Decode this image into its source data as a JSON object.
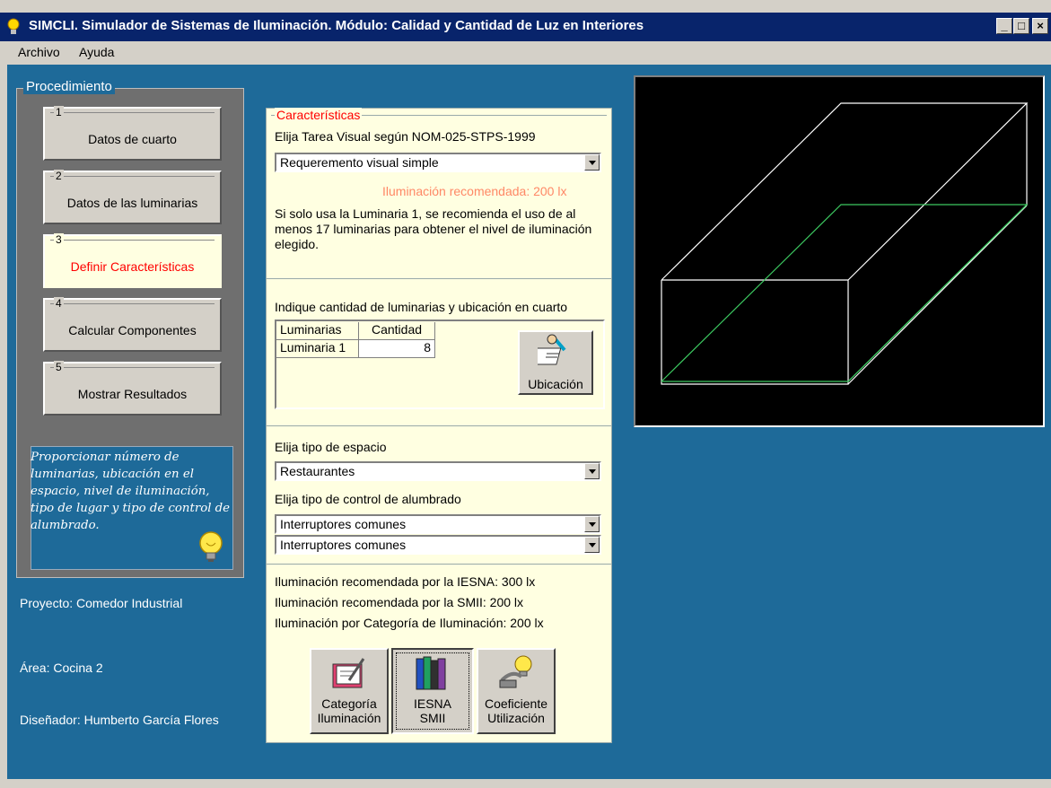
{
  "window": {
    "title": "SIMCLI. Simulador de Sistemas de Iluminación. Módulo: Calidad y Cantidad de Luz en Interiores",
    "buttons": {
      "min": "_",
      "max": "□",
      "close": "×"
    }
  },
  "menu": [
    "Archivo",
    "Ayuda"
  ],
  "procedure": {
    "legend": "Procedimiento",
    "steps": [
      {
        "num": "1",
        "label": "Datos de cuarto"
      },
      {
        "num": "2",
        "label": "Datos de las luminarias"
      },
      {
        "num": "3",
        "label": "Definir Características"
      },
      {
        "num": "4",
        "label": "Calcular Componentes"
      },
      {
        "num": "5",
        "label": "Mostrar Resultados"
      }
    ],
    "active_step": 3,
    "hint": "Proporcionar número de luminarias, ubicación en el espacio, nivel de iluminación, tipo de lugar y tipo de control de alumbrado."
  },
  "project": {
    "proyecto": "Proyecto: Comedor Industrial",
    "area": "Área: Cocina 2",
    "disenador": "Diseñador: Humberto García Flores"
  },
  "characteristics": {
    "legend": "Características",
    "task_label": "Elija Tarea Visual según NOM-025-STPS-1999",
    "task_value": "Requeremento visual simple",
    "recommended": "Iluminación recomendada: 200  lx",
    "note": "Si solo usa la Luminaria 1, se recomienda el uso de al menos 17 luminarias para obtener el nivel de iluminación elegido."
  },
  "luminaires": {
    "label": "Indique cantidad de luminarias y ubicación en cuarto",
    "headers": [
      "Luminarias",
      "Cantidad"
    ],
    "rows": [
      {
        "name": "Luminaria 1",
        "qty": "8"
      }
    ],
    "location_button": "Ubicación"
  },
  "space": {
    "type_label": "Elija tipo de espacio",
    "type_value": "Restaurantes",
    "control_label": "Elija tipo de control de alumbrado",
    "control_1": "Interruptores comunes",
    "control_2": "Interruptores comunes"
  },
  "recommendations": {
    "iesna": "Iluminación recomendada por la IESNA: 300  lx",
    "smii": "Iluminación recomendada por la SMII: 200  lx",
    "categoria": "Iluminación por Categoría de Iluminación: 200  lx"
  },
  "bottom_buttons": [
    {
      "line1": "Categoría",
      "line2": "Iluminación"
    },
    {
      "line1": "IESNA",
      "line2": "SMII"
    },
    {
      "line1": "Coeficiente",
      "line2": "Utilización"
    }
  ],
  "colors": {
    "client_bg": "#1e6a99",
    "panel_bg": "#ffffe1",
    "active_text": "#ff0000",
    "room_lines": "#ffffff",
    "workplane_lines": "#3cc860"
  }
}
